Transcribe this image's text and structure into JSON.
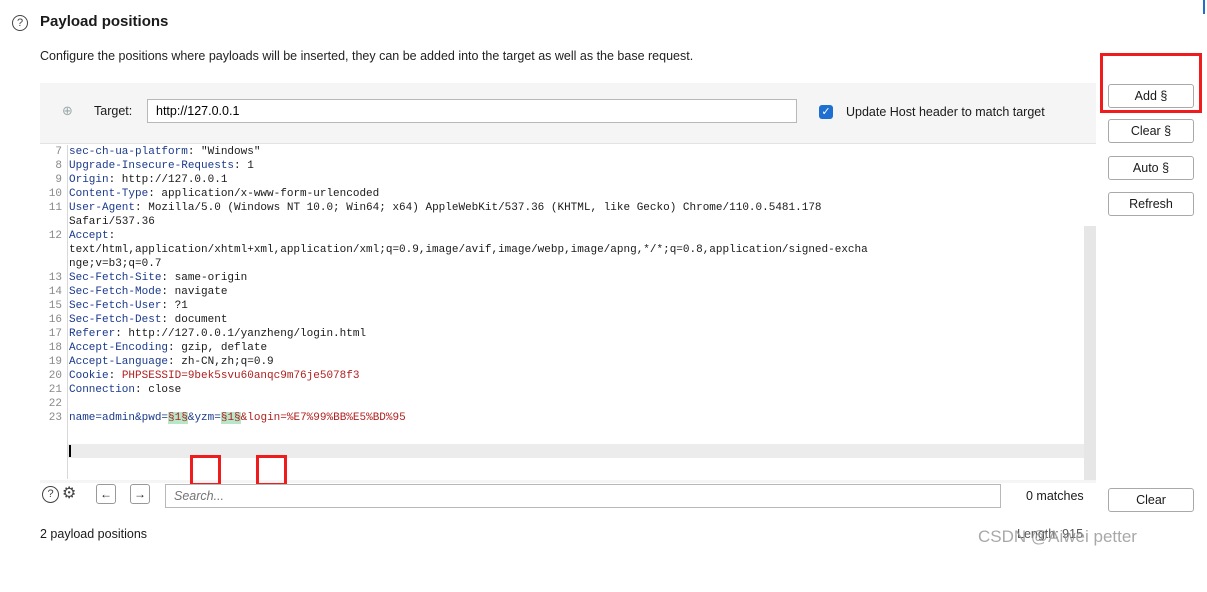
{
  "section": {
    "title": "Payload positions",
    "description": "Configure the positions where payloads will be inserted, they can be added into the target as well as the base request."
  },
  "target": {
    "label": "Target:",
    "value": "http://127.0.0.1",
    "update_host_label": "Update Host header to match target",
    "update_host_checked": true
  },
  "buttons": {
    "add": "Add §",
    "clear_markers": "Clear §",
    "auto": "Auto §",
    "refresh": "Refresh",
    "clear": "Clear"
  },
  "request_lines": [
    {
      "n": "7",
      "key": "sec-ch-ua-platform",
      "val": ": \"Windows\""
    },
    {
      "n": "8",
      "key": "Upgrade-Insecure-Requests",
      "val": ": 1"
    },
    {
      "n": "9",
      "key": "Origin",
      "val": ": http://127.0.0.1"
    },
    {
      "n": "10",
      "key": "Content-Type",
      "val": ": application/x-www-form-urlencoded"
    },
    {
      "n": "11",
      "key": "User-Agent",
      "val": ": Mozilla/5.0 (Windows NT 10.0; Win64; x64) AppleWebKit/537.36 (KHTML, like Gecko) Chrome/110.0.5481.178"
    },
    {
      "n": "",
      "key": "",
      "val": "Safari/537.36"
    },
    {
      "n": "12",
      "key": "Accept",
      "val": ":"
    },
    {
      "n": "",
      "key": "",
      "val": "text/html,application/xhtml+xml,application/xml;q=0.9,image/avif,image/webp,image/apng,*/*;q=0.8,application/signed-excha"
    },
    {
      "n": "",
      "key": "",
      "val": "nge;v=b3;q=0.7"
    },
    {
      "n": "13",
      "key": "Sec-Fetch-Site",
      "val": ": same-origin"
    },
    {
      "n": "14",
      "key": "Sec-Fetch-Mode",
      "val": ": navigate"
    },
    {
      "n": "15",
      "key": "Sec-Fetch-User",
      "val": ": ?1"
    },
    {
      "n": "16",
      "key": "Sec-Fetch-Dest",
      "val": ": document"
    },
    {
      "n": "17",
      "key": "Referer",
      "val": ": http://127.0.0.1/yanzheng/login.html"
    },
    {
      "n": "18",
      "key": "Accept-Encoding",
      "val": ": gzip, deflate"
    },
    {
      "n": "19",
      "key": "Accept-Language",
      "val": ": zh-CN,zh;q=0.9"
    },
    {
      "n": "20",
      "key": "Cookie",
      "val": ": ",
      "red": "PHPSESSID=9bek5svu60anqc9m76je5078f3"
    },
    {
      "n": "21",
      "key": "Connection",
      "val": ": close"
    },
    {
      "n": "22",
      "key": "",
      "val": ""
    }
  ],
  "body_line": {
    "n": "23",
    "p1": "name=admin&pwd=",
    "m1": "§1§",
    "p2": "&yzm=",
    "m2": "§1§",
    "p3": "&login=%E7%99%BB%E5%BD%95"
  },
  "search": {
    "placeholder": "Search...",
    "matches": "0 matches"
  },
  "footer": {
    "positions": "2 payload positions",
    "length": "Length: 915",
    "watermark": "CSDN @Aiwei petter"
  }
}
